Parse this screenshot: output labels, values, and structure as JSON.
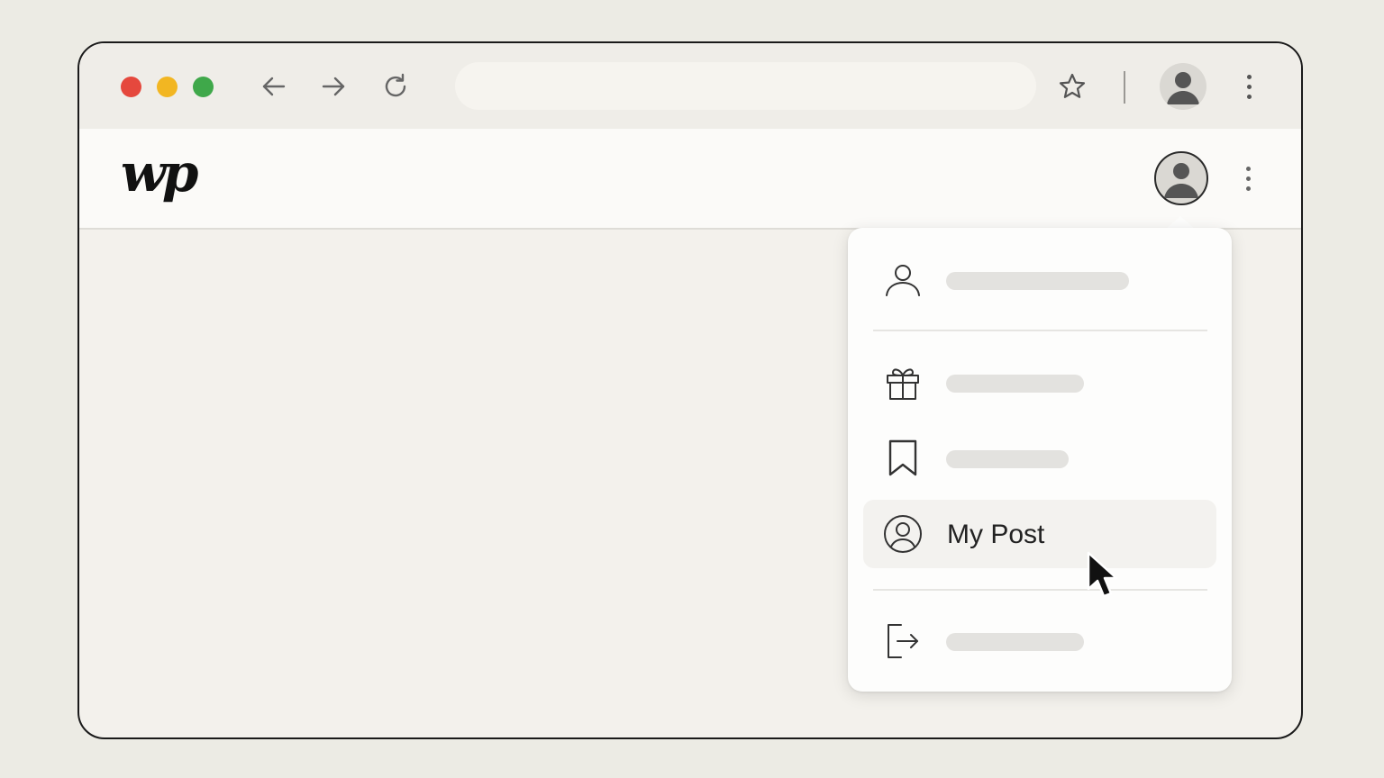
{
  "browser": {
    "address_value": "",
    "traffic_lights": {
      "close": "#e5483d",
      "minimize": "#f2b622",
      "maximize": "#3fa84a"
    },
    "icons": [
      "back-arrow-icon",
      "forward-arrow-icon",
      "reload-icon",
      "star-icon",
      "profile-icon",
      "more-vertical-icon"
    ]
  },
  "site": {
    "logo_text": "wp"
  },
  "account_menu": {
    "items": [
      {
        "id": "profile",
        "icon": "person-icon",
        "label": ""
      },
      {
        "id": "gift",
        "icon": "gift-icon",
        "label": ""
      },
      {
        "id": "saved",
        "icon": "bookmark-icon",
        "label": ""
      },
      {
        "id": "my-post",
        "icon": "user-circle-icon",
        "label": "My Post",
        "hovered": true
      },
      {
        "id": "sign-out",
        "icon": "sign-out-icon",
        "label": ""
      }
    ]
  }
}
